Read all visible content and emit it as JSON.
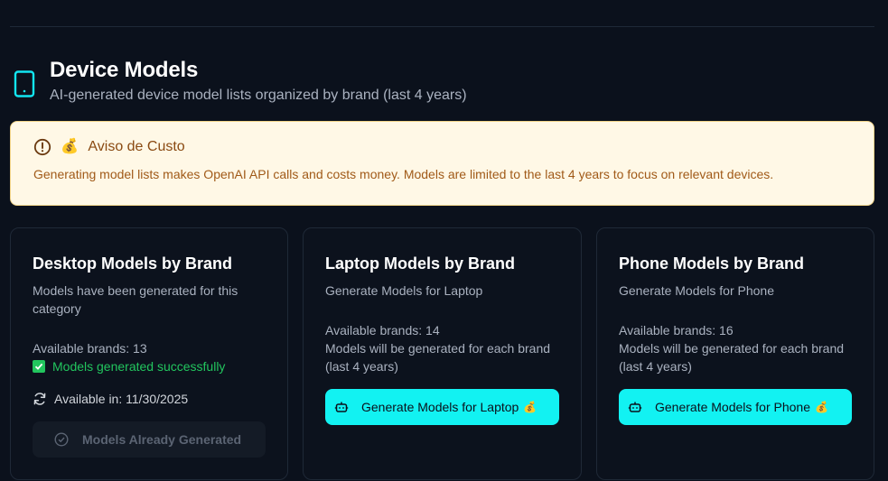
{
  "header": {
    "title": "Device Models",
    "subtitle": "AI-generated device model lists organized by brand (last 4 years)",
    "icon": "phone-icon"
  },
  "warning": {
    "icon": "alert-circle-icon",
    "emoji": "💰",
    "title": "Aviso de Custo",
    "body": "Generating model lists makes OpenAI API calls and costs money. Models are limited to the last 4 years to focus on relevant devices."
  },
  "cards": [
    {
      "title": "Desktop Models by Brand",
      "description": "Models have been generated for this category",
      "available_brands": "Available brands: 13",
      "status": "Models generated successfully",
      "available_in": "Available in: 11/30/2025",
      "button_label": "Models Already Generated"
    },
    {
      "title": "Laptop Models by Brand",
      "description": "Generate Models for Laptop",
      "available_brands": "Available brands: 14",
      "note": "Models will be generated for each brand (last 4 years)",
      "button_label": "Generate Models for Laptop",
      "button_emoji": "💰"
    },
    {
      "title": "Phone Models by Brand",
      "description": "Generate Models for Phone",
      "available_brands": "Available brands: 16",
      "note": "Models will be generated for each brand (last 4 years)",
      "button_label": "Generate Models for Phone",
      "button_emoji": "💰"
    }
  ],
  "colors": {
    "background": "#0b111c",
    "accent": "#12f2f2",
    "success": "#22c55e",
    "warning_bg": "#fff8e6",
    "warning_text": "#a05a18"
  }
}
